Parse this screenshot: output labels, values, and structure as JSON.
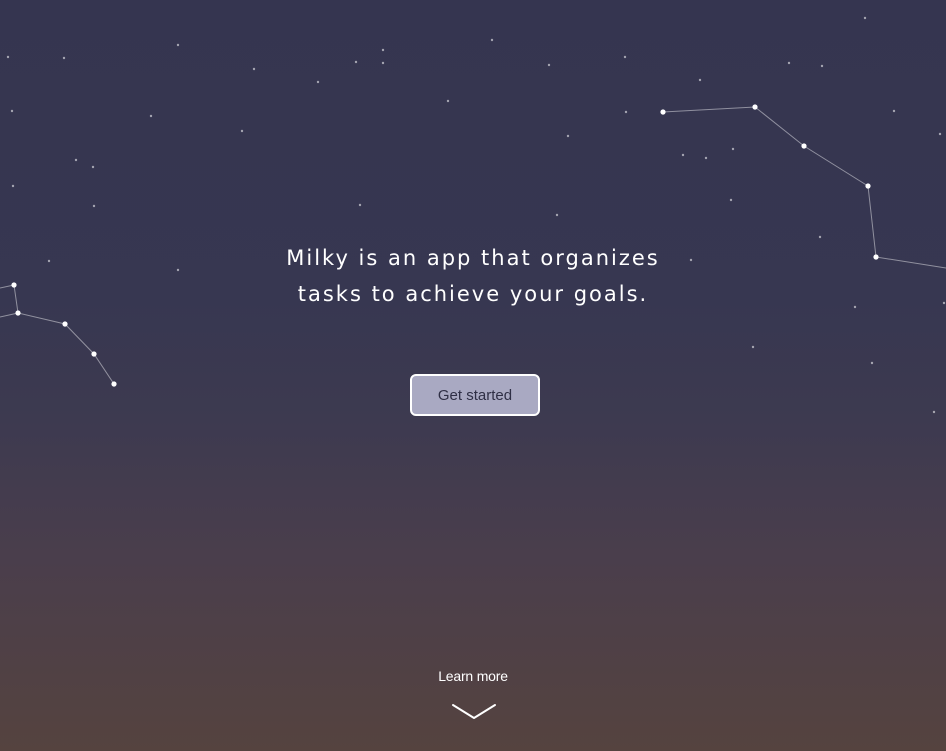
{
  "hero": {
    "tagline_line1": "Milky is an app that organizes",
    "tagline_line2": "tasks to achieve your goals.",
    "cta_label": "Get started",
    "learn_more_label": "Learn more",
    "scroll_icon": "chevron-down-icon"
  },
  "colors": {
    "sky_top": "#353550",
    "sky_bottom": "#55433f",
    "button_fill": "#a9a9c2",
    "button_text": "#2f2f45",
    "text": "#ffffff"
  }
}
